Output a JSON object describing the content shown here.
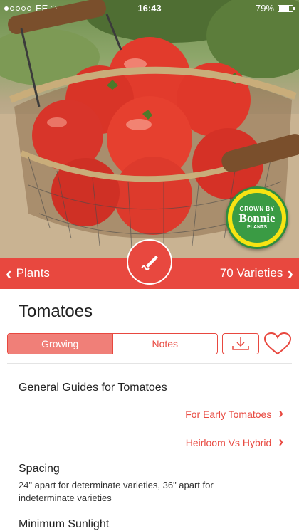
{
  "status_bar": {
    "carrier": "EE",
    "time": "16:43",
    "battery": "79%",
    "battery_level": 0.79
  },
  "badge": {
    "top_text": "GROWN BY",
    "brand": "Bonnie",
    "bottom_text": "PLANTS"
  },
  "nav": {
    "back_label": "Plants",
    "forward_label": "70 Varieties"
  },
  "page": {
    "title": "Tomatoes"
  },
  "segments": {
    "growing": "Growing",
    "notes": "Notes",
    "selected": "Growing"
  },
  "guides": {
    "heading": "General Guides for Tomatoes",
    "links": [
      "For Early Tomatoes",
      "Heirloom Vs Hybrid"
    ]
  },
  "spacing": {
    "heading": "Spacing",
    "text": "24\" apart for determinate varieties, 36\" apart for indeterminate varieties"
  },
  "sunlight": {
    "heading": "Minimum Sunlight"
  },
  "colors": {
    "accent": "#e8483f",
    "segment_active": "#f07f78",
    "badge_yellow": "#f7e313",
    "badge_green": "#3a9b44"
  },
  "icons": {
    "fab": "pen-scribble-icon",
    "download": "download-tray-icon",
    "favorite": "heart-icon",
    "back": "chevron-left-icon",
    "forward": "chevron-right-icon"
  }
}
